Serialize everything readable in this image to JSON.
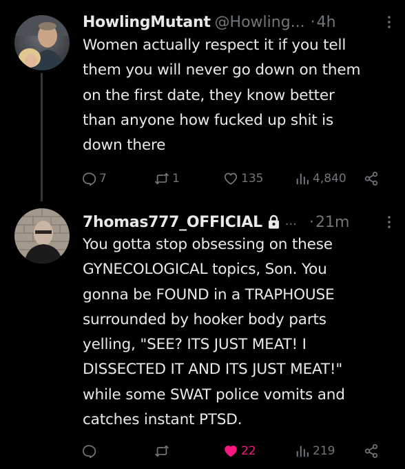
{
  "tweets": [
    {
      "display_name": "HowlingMutant",
      "handle": "@Howling...",
      "separator": "·",
      "time": "4h",
      "text": "Women actually respect it if you tell\nthem you will never go down on them\non the first date, they know better\nthan anyone how fucked up shit is\ndown there",
      "replies": "7",
      "reposts": "1",
      "likes": "135",
      "views": "4,840",
      "liked": false
    },
    {
      "display_name": "7homas777_OFFICIAL",
      "ellipsis": "...",
      "separator": "·",
      "time": "21m",
      "text": "You gotta stop obsessing on these\nGYNECOLOGICAL topics, Son. You\ngonna be FOUND in a TRAPHOUSE\nsurrounded by hooker body parts\nyelling, \"SEE? ITS JUST MEAT! I\nDISSECTED IT AND ITS JUST MEAT!\"\nwhile some SWAT police vomits and\ncatches instant PTSD.",
      "replies": "",
      "reposts": "",
      "likes": "22",
      "views": "219",
      "liked": true
    }
  ],
  "colors": {
    "background": "#000000",
    "text_primary": "#e7e9ea",
    "text_secondary": "#71767b",
    "like_active": "#f91880",
    "thread_line": "#333639"
  },
  "icons": [
    "reply-icon",
    "repost-icon",
    "like-icon",
    "views-icon",
    "share-icon",
    "more-icon",
    "lock-icon"
  ]
}
